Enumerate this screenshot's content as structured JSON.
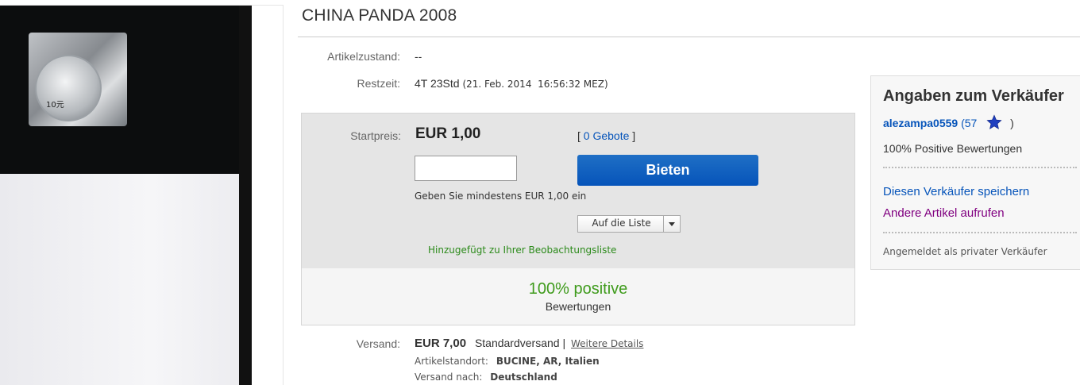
{
  "listing": {
    "title": "CHINA PANDA 2008",
    "coin_marking": "10元"
  },
  "details": {
    "condition_label": "Artikelzustand:",
    "condition_value": "--",
    "time_left_label": "Restzeit:",
    "time_left_value": "4T 23Std",
    "end_time": "(21. Feb. 2014  16:56:32 MEZ)"
  },
  "bid": {
    "start_price_label": "Startpreis:",
    "start_price": "EUR 1,00",
    "bids_open": "[",
    "bids_link": "0 Gebote",
    "bids_close": "]",
    "input_value": "",
    "button_label": "Bieten",
    "hint": "Geben Sie mindestens EUR 1,00 ein",
    "watch_label": "Auf die Liste",
    "added_msg": "Hinzugefügt zu Ihrer Beobachtungsliste",
    "feedback_pct": "100% positive",
    "feedback_label": "Bewertungen"
  },
  "shipping": {
    "label": "Versand:",
    "price": "EUR 7,00",
    "method": "Standardversand",
    "separator": "|",
    "details_link": "Weitere Details",
    "location_label": "Artikelstandort:",
    "location_value": "BUCINE, AR, Italien",
    "ships_to_label": "Versand nach:",
    "ships_to_value": "Deutschland"
  },
  "seller": {
    "heading": "Angaben zum Verkäufer",
    "username": "alezampa0559",
    "score_open": "(57",
    "score_close": ")",
    "star_color": "#1f3fbf",
    "positive": "100% Positive Bewertungen",
    "save_link": "Diesen Verkäufer speichern",
    "other_items_link": "Andere Artikel aufrufen",
    "account_type": "Angemeldet als privater Verkäufer"
  },
  "colors": {
    "link": "#0654ba",
    "visited_link": "#800080",
    "positive_green": "#3f9b1c",
    "button_blue": "#0654ba"
  }
}
